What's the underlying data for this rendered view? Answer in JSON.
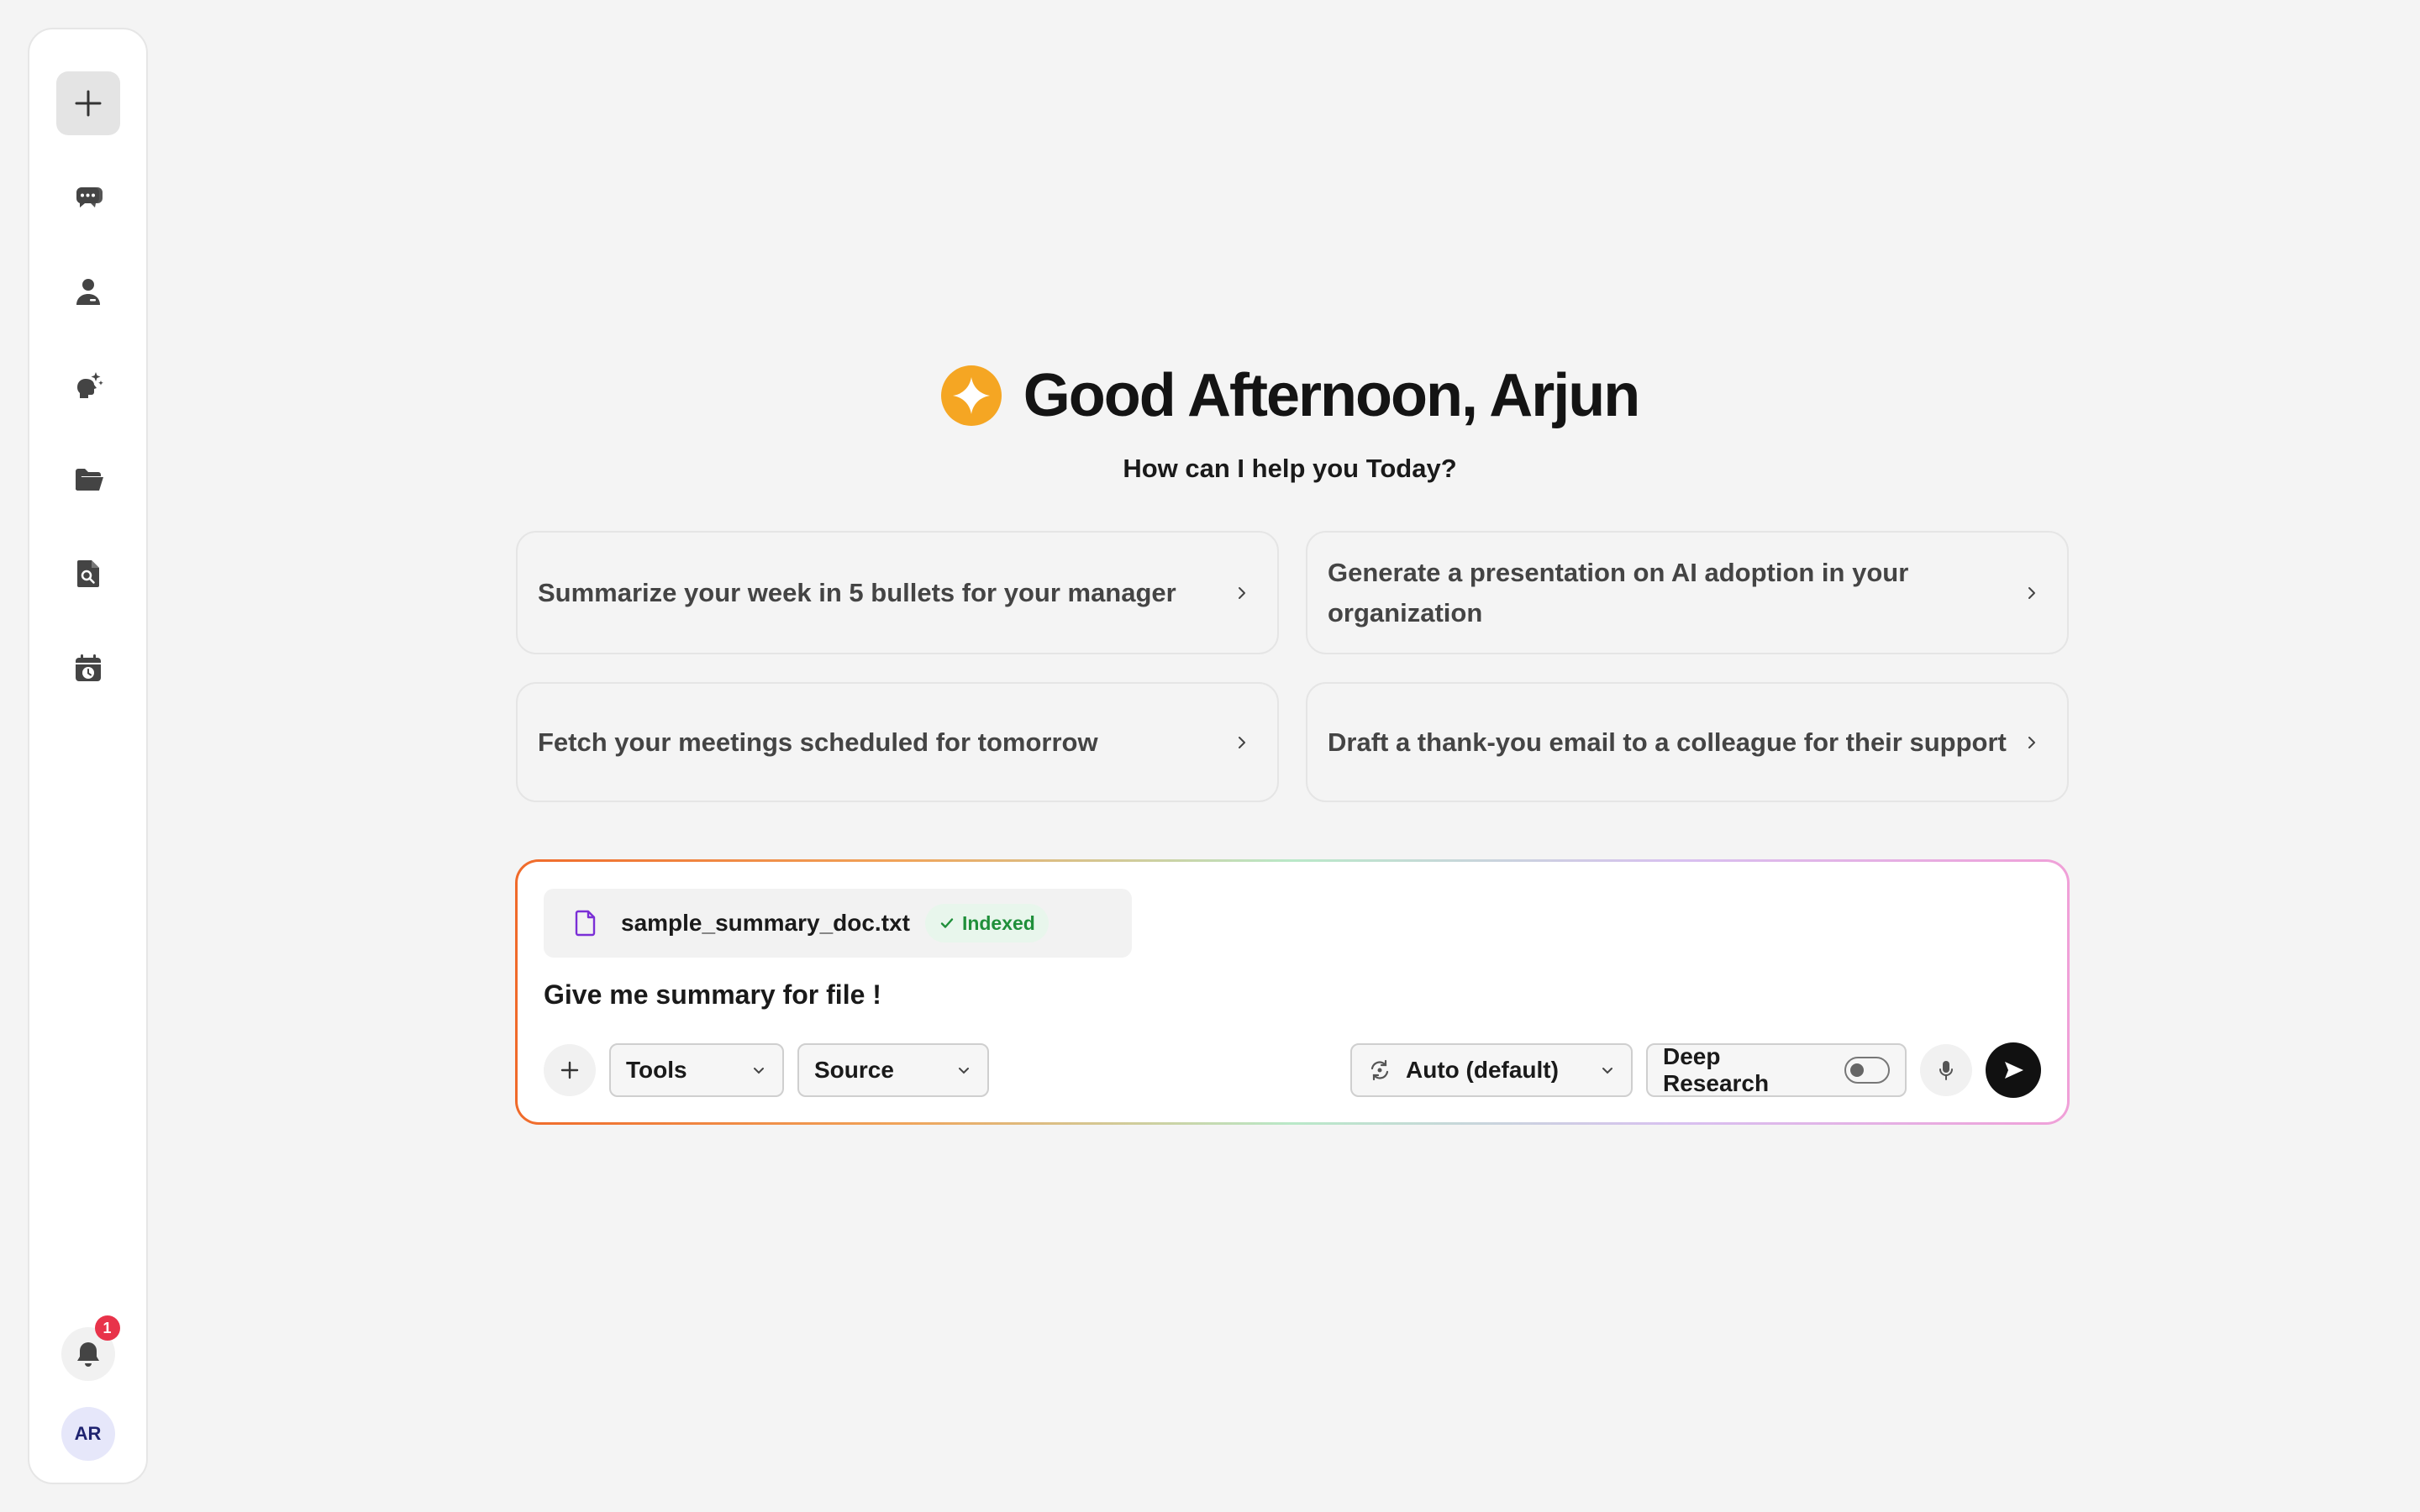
{
  "sidebar": {
    "items": [
      {
        "name": "new-chat",
        "icon": "plus-icon"
      },
      {
        "name": "chats",
        "icon": "chat-bubbles-icon"
      },
      {
        "name": "agents",
        "icon": "person-icon"
      },
      {
        "name": "ai-studio",
        "icon": "sparkle-brain-icon"
      },
      {
        "name": "files",
        "icon": "folder-icon"
      },
      {
        "name": "document-search",
        "icon": "file-search-icon"
      },
      {
        "name": "calendar",
        "icon": "calendar-clock-icon"
      }
    ],
    "notifications_count": "1",
    "avatar_initials": "AR"
  },
  "greeting": {
    "title": "Good Afternoon, Arjun",
    "subtitle": "How can I help you Today?"
  },
  "suggestions": [
    "Summarize your week in 5 bullets for your manager",
    "Generate a presentation on AI adoption in your organization",
    "Fetch your meetings scheduled for tomorrow",
    "Draft a thank-you email to a colleague for their support"
  ],
  "composer": {
    "attachment": {
      "filename": "sample_summary_doc.txt",
      "status": "Indexed"
    },
    "prompt": "Give me summary for file !",
    "tools_label": "Tools",
    "source_label": "Source",
    "model_label": "Auto (default)",
    "deep_research_label": "Deep Research",
    "deep_research_enabled": false
  },
  "colors": {
    "accent_logo": "#f5a623",
    "indexed_green": "#1f8f3a",
    "badge_red": "#e8334a",
    "file_icon_purple": "#7b2fd6"
  }
}
